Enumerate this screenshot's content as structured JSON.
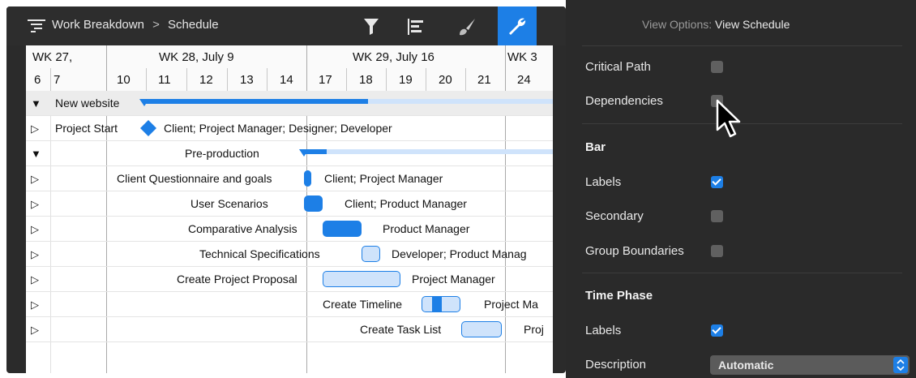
{
  "toolbar": {
    "breadcrumb_parent": "Work Breakdown",
    "breadcrumb_separator": ">",
    "breadcrumb_current": "Schedule",
    "icons": [
      "filter-icon",
      "outline-icon",
      "style-icon",
      "wrench-icon"
    ]
  },
  "timeline": {
    "weeks": [
      "WK 27,",
      "WK 28, July 9",
      "WK 29, July 16",
      "WK 3"
    ],
    "days": [
      "6",
      "7",
      "10",
      "11",
      "12",
      "13",
      "14",
      "17",
      "18",
      "19",
      "20",
      "21",
      "24"
    ]
  },
  "rows": [
    {
      "label": "New website",
      "assignees": ""
    },
    {
      "label": "Project Start",
      "assignees": "Client; Project Manager; Designer; Developer"
    },
    {
      "label": "Pre-production",
      "assignees": ""
    },
    {
      "label": "Client Questionnaire and goals",
      "assignees": "Client; Project Manager"
    },
    {
      "label": "User Scenarios",
      "assignees": "Client; Product Manager"
    },
    {
      "label": "Comparative Analysis",
      "assignees": "Product Manager"
    },
    {
      "label": "Technical Specifications",
      "assignees": "Developer; Product Manag"
    },
    {
      "label": "Create Project Proposal",
      "assignees": "Project Manager"
    },
    {
      "label": "Create Timeline",
      "assignees": "Project Ma"
    },
    {
      "label": "Create Task List",
      "assignees": "Proj"
    }
  ],
  "panel": {
    "title_prefix": "View Options:",
    "title_value": "View Schedule",
    "critical_path": "Critical Path",
    "dependencies": "Dependencies",
    "bar_heading": "Bar",
    "bar_labels": "Labels",
    "secondary": "Secondary",
    "group_boundaries": "Group Boundaries",
    "time_phase_heading": "Time Phase",
    "tp_labels": "Labels",
    "description": "Description",
    "description_value": "Automatic"
  },
  "colors": {
    "accent": "#1d7fe6",
    "bar_light": "#cfe3fb",
    "panel_bg": "#2a2a2a"
  }
}
